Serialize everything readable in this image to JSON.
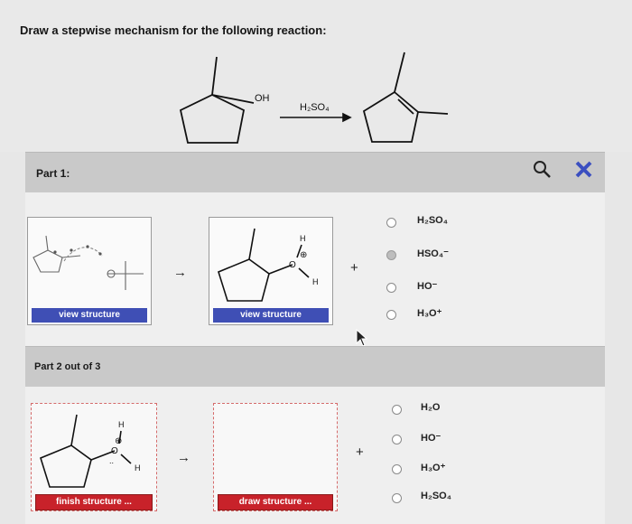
{
  "question": {
    "title": "Draw a stepwise mechanism for the following reaction:",
    "reagent": "H₂SO₄",
    "oh_label": "OH"
  },
  "part1": {
    "label": "Part 1:",
    "arrow": "→",
    "plus": "+",
    "view_button_1": "view structure",
    "view_button_2": "view structure",
    "intermediate_labels": {
      "h_top": "H",
      "h_right": "H",
      "o": "O",
      "charge": "⊕"
    },
    "options": [
      {
        "label": "H₂SO₄",
        "selected": false
      },
      {
        "label": "HSO₄⁻",
        "selected": true
      },
      {
        "label": "HO⁻",
        "selected": false
      },
      {
        "label": "H₃O⁺",
        "selected": false
      }
    ]
  },
  "part2": {
    "label": "Part 2 out of 3",
    "arrow": "→",
    "plus": "+",
    "finish_button": "finish structure ...",
    "draw_button": "draw structure ...",
    "structure_labels": {
      "h_top": "H",
      "o": "O",
      "charge": "⊕",
      "h_right": "H",
      "lone_pair": ".."
    },
    "options": [
      {
        "label": "H₂O",
        "selected": false
      },
      {
        "label": "HO⁻",
        "selected": false
      },
      {
        "label": "H₃O⁺",
        "selected": false
      },
      {
        "label": "H₂SO₄",
        "selected": false
      }
    ]
  },
  "toolbar": {
    "search_icon": "magnifier-icon",
    "close_icon": "x-icon"
  },
  "colors": {
    "button_blue": "#3f4fb5",
    "button_red": "#c8222a",
    "close_x": "#3b4fc0"
  }
}
